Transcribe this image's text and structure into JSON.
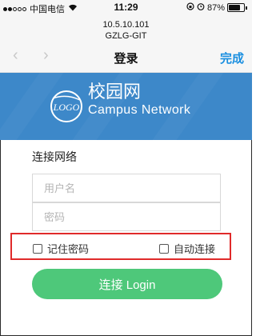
{
  "status_bar": {
    "carrier": "中国电信",
    "time": "11:29",
    "battery_percent": "87%",
    "battery_level": 0.87,
    "signal_bars_filled": 2,
    "signal_bars_total": 5
  },
  "nav": {
    "ip_address": "10.5.10.101",
    "ssid": "GZLG-GIT",
    "back_glyph": "‹",
    "forward_glyph": "›",
    "title": "登录",
    "done_label": "完成"
  },
  "banner": {
    "logo_text": "LOGO",
    "title": "校园网",
    "subtitle": "Campus Network",
    "background_color": "#3d88c9"
  },
  "form": {
    "section_title": "连接网络",
    "username_placeholder": "用户名",
    "username_value": "",
    "password_placeholder": "密码",
    "password_value": "",
    "remember_password_label": "记住密码",
    "remember_password_checked": false,
    "auto_connect_label": "自动连接",
    "auto_connect_checked": false,
    "login_button_label": "连接 Login"
  },
  "colors": {
    "accent": "#1a8fe0",
    "login_button": "#4ec87a",
    "highlight_box": "#e02a2a"
  },
  "icons": {
    "status_alarm": "alarm-icon",
    "status_lock": "rotation-lock-icon",
    "status_wifi": "wifi-icon",
    "battery": "battery-icon"
  }
}
